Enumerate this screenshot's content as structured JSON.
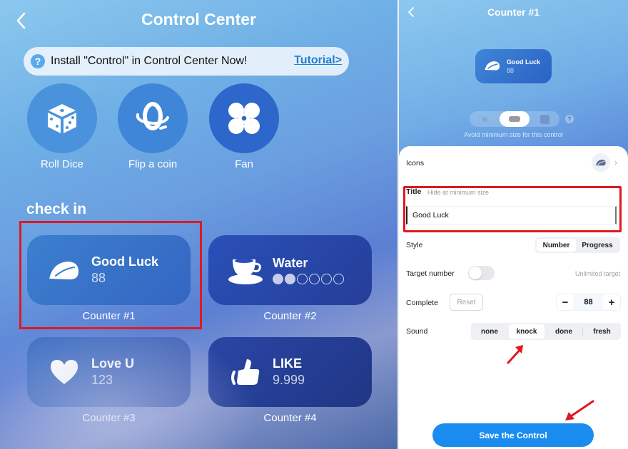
{
  "left_screen": {
    "header": {
      "title": "Control Center",
      "back_icon": "chevron-left-icon"
    },
    "banner": {
      "icon": "question-circle-icon",
      "icon_glyph": "?",
      "text": "Install \"Control\" in Control Center Now!",
      "link": "Tutorial>"
    },
    "quick_actions": [
      {
        "label": "Roll Dice",
        "icon": "dice-icon"
      },
      {
        "label": "Flip a coin",
        "icon": "coin-flip-icon"
      },
      {
        "label": "Fan",
        "icon": "fan-icon"
      }
    ],
    "section_title": "check in",
    "counters": [
      {
        "name": "Good Luck",
        "value": "88",
        "caption": "Counter #1",
        "icon": "leaf-icon",
        "highlighted": true
      },
      {
        "name": "Water",
        "progress_filled": 2,
        "progress_total": 6,
        "caption": "Counter #2",
        "icon": "coffee-cup-icon"
      },
      {
        "name": "Love U",
        "value": "123",
        "caption": "Counter #3",
        "icon": "heart-icon"
      },
      {
        "name": "LIKE",
        "value": "9.999",
        "caption": "Counter #4",
        "icon": "thumbs-up-icon"
      }
    ]
  },
  "right_screen": {
    "header": {
      "title": "Counter #1",
      "back_icon": "chevron-left-icon"
    },
    "preview": {
      "name": "Good Luck",
      "value": "88",
      "icon": "leaf-icon"
    },
    "size_selector": {
      "options": [
        "small",
        "medium",
        "large"
      ],
      "selected": "medium",
      "help_glyph": "?",
      "hint": "Avoid minimum size for this control"
    },
    "form": {
      "icons_label": "Icons",
      "icon_selected": "leaf-icon",
      "title_label": "Title",
      "title_hint": "Hide at minimum size",
      "title_value": "Good Luck",
      "style_label": "Style",
      "style_options": [
        "Number",
        "Progress"
      ],
      "style_selected": "Number",
      "target_label": "Target number",
      "target_enabled": false,
      "target_hint": "Unlimited target",
      "complete_label": "Complete",
      "reset_label": "Reset",
      "stepper_minus": "−",
      "stepper_value": "88",
      "stepper_plus": "+",
      "sound_label": "Sound",
      "sound_options": [
        "none",
        "knock",
        "done",
        "fresh"
      ],
      "sound_selected": "knock"
    },
    "save_button": "Save the Control"
  },
  "colors": {
    "accent_blue": "#1a8cf0",
    "highlight_red": "#e01820",
    "link_blue": "#1f7fd0"
  }
}
